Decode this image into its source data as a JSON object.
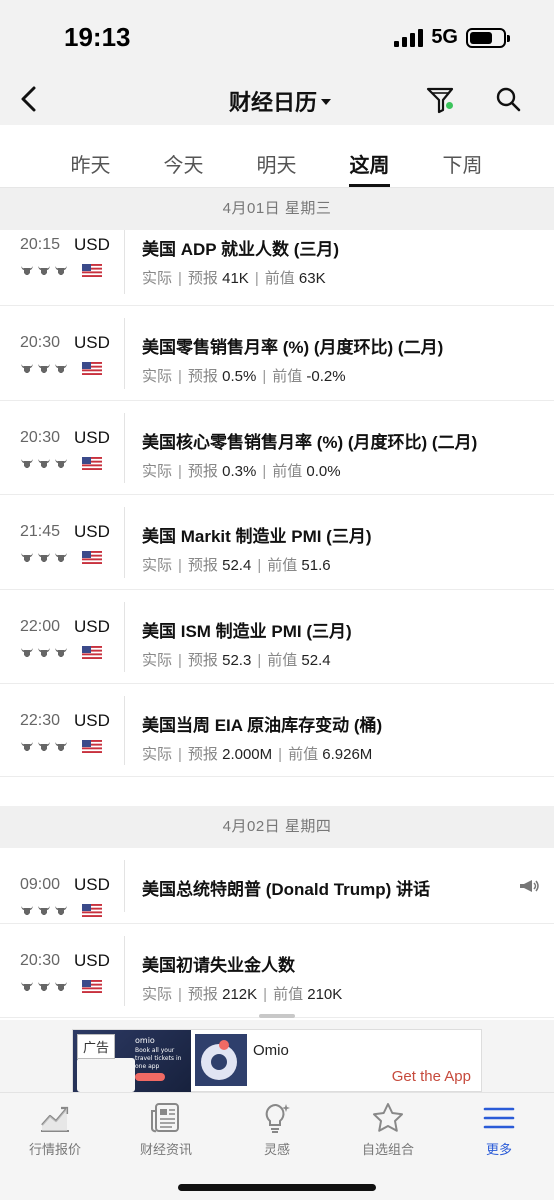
{
  "status_bar": {
    "time": "19:13",
    "network": "5G",
    "battery_level": 0.7
  },
  "nav": {
    "title": "财经日历",
    "back_icon": "chevron-left-icon",
    "filter_icon": "filter-icon",
    "search_icon": "search-icon",
    "filter_active_color": "#3cc45c"
  },
  "tabs": [
    {
      "label": "昨天",
      "active": false
    },
    {
      "label": "今天",
      "active": false
    },
    {
      "label": "明天",
      "active": false
    },
    {
      "label": "这周",
      "active": true
    },
    {
      "label": "下周",
      "active": false
    }
  ],
  "days": [
    {
      "header": "4月01日  星期三",
      "events": [
        {
          "time": "20:15",
          "currency": "USD",
          "importance": 3,
          "title": "美国 ADP 就业人数 (三月)",
          "actual_label": "实际",
          "forecast_label": "预报",
          "forecast": "41K",
          "previous_label": "前值",
          "previous": "63K"
        },
        {
          "time": "20:30",
          "currency": "USD",
          "importance": 3,
          "title": "美国零售销售月率 (%) (月度环比) (二月)",
          "actual_label": "实际",
          "forecast_label": "预报",
          "forecast": "0.5%",
          "previous_label": "前值",
          "previous": "-0.2%"
        },
        {
          "time": "20:30",
          "currency": "USD",
          "importance": 3,
          "title": "美国核心零售销售月率 (%) (月度环比) (二月)",
          "actual_label": "实际",
          "forecast_label": "预报",
          "forecast": "0.3%",
          "previous_label": "前值",
          "previous": "0.0%"
        },
        {
          "time": "21:45",
          "currency": "USD",
          "importance": 3,
          "title": "美国 Markit 制造业 PMI (三月)",
          "actual_label": "实际",
          "forecast_label": "预报",
          "forecast": "52.4",
          "previous_label": "前值",
          "previous": "51.6"
        },
        {
          "time": "22:00",
          "currency": "USD",
          "importance": 3,
          "title": "美国 ISM 制造业 PMI (三月)",
          "actual_label": "实际",
          "forecast_label": "预报",
          "forecast": "52.3",
          "previous_label": "前值",
          "previous": "52.4"
        },
        {
          "time": "22:30",
          "currency": "USD",
          "importance": 3,
          "title": "美国当周 EIA 原油库存变动 (桶)",
          "actual_label": "实际",
          "forecast_label": "预报",
          "forecast": "2.000M",
          "previous_label": "前值",
          "previous": "6.926M"
        }
      ]
    },
    {
      "header": "4月02日  星期四",
      "events": [
        {
          "time": "09:00",
          "currency": "USD",
          "importance": 3,
          "title": "美国总统特朗普 (Donald Trump) 讲话",
          "speech": true
        },
        {
          "time": "20:30",
          "currency": "USD",
          "importance": 3,
          "title": "美国初请失业金人数",
          "actual_label": "实际",
          "forecast_label": "预报",
          "forecast": "212K",
          "previous_label": "前值",
          "previous": "210K"
        }
      ]
    }
  ],
  "ad": {
    "badge": "广告",
    "image_brand": "omio",
    "image_tagline": "Book all your travel tickets in one app",
    "name": "Omio",
    "cta": "Get the App"
  },
  "bottom_nav": [
    {
      "label": "行情报价",
      "icon": "chart-trend-icon",
      "active": false
    },
    {
      "label": "财经资讯",
      "icon": "newspaper-icon",
      "active": false
    },
    {
      "label": "灵感",
      "icon": "lightbulb-icon",
      "active": false
    },
    {
      "label": "自选组合",
      "icon": "star-icon",
      "active": false
    },
    {
      "label": "更多",
      "icon": "menu-icon",
      "active": true
    }
  ],
  "colors": {
    "accent": "#2a5bd7",
    "cta": "#c64a3c"
  }
}
